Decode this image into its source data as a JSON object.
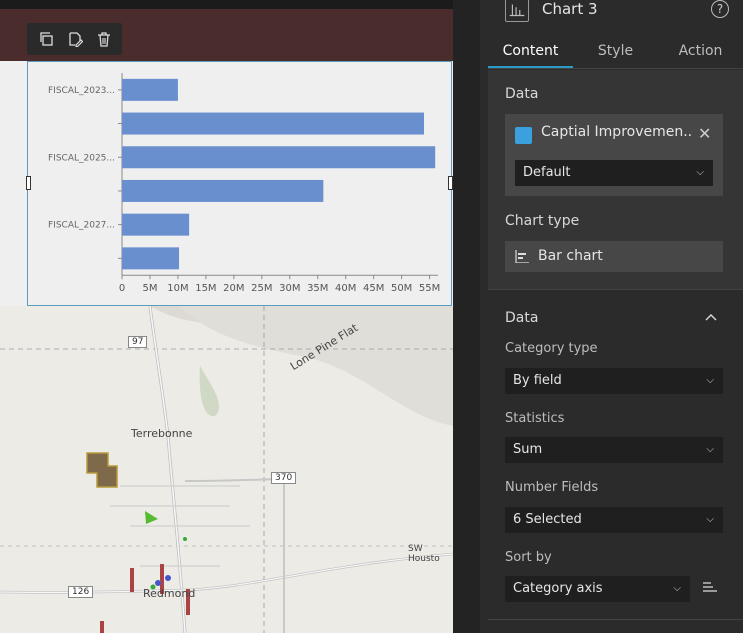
{
  "toolbar": {
    "duplicate_icon": "copy-icon",
    "edit_icon": "edit-icon",
    "delete_icon": "trash-icon"
  },
  "chart_data": {
    "type": "bar",
    "orientation": "horizontal",
    "categories": [
      "FISCAL_2023...",
      "",
      "FISCAL_2025...",
      "",
      "FISCAL_2027...",
      ""
    ],
    "values": [
      10,
      54,
      56,
      36,
      12,
      10.2
    ],
    "xticks": [
      "0",
      "5M",
      "10M",
      "15M",
      "20M",
      "25M",
      "30M",
      "35M",
      "40M",
      "45M",
      "50M",
      "55M"
    ],
    "xlim": [
      0,
      56.5
    ],
    "color": "#6a8fcf"
  },
  "map": {
    "labels": {
      "terrebonne": "Terrebonne",
      "redmond": "Redmond",
      "lone_pine": "Lone Pine Flat",
      "sw_house": "SW Housto"
    },
    "shields": {
      "us97": "97",
      "hwy370": "370",
      "hwy126": "126"
    }
  },
  "panel": {
    "title": "Chart 3",
    "help": "?",
    "tabs": [
      "Content",
      "Style",
      "Action"
    ],
    "data_heading": "Data",
    "datasource_name": "Captial Improvemen...",
    "datasource_close": "✕",
    "view_select": "Default",
    "chart_type_heading": "Chart type",
    "chart_type_value": "Bar chart",
    "section2_title": "Data",
    "category_type_label": "Category type",
    "category_type_value": "By field",
    "statistics_label": "Statistics",
    "statistics_value": "Sum",
    "number_fields_label": "Number Fields",
    "number_fields_value": "6 Selected",
    "sort_by_label": "Sort by",
    "sort_by_value": "Category axis"
  }
}
